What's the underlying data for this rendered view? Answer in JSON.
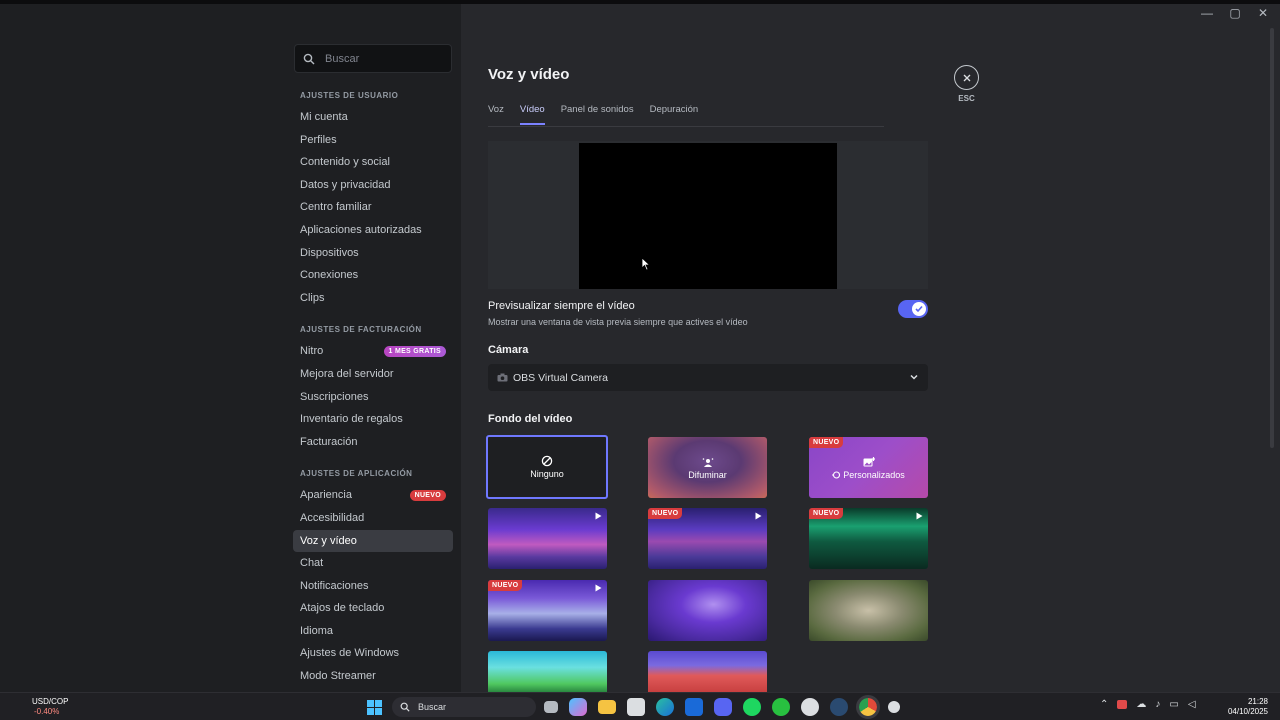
{
  "window": {
    "minimize": "—",
    "maximize": "▢",
    "close": "✕"
  },
  "search": {
    "placeholder": "Buscar"
  },
  "sidebar": {
    "user_header": "AJUSTES DE USUARIO",
    "user_items": [
      "Mi cuenta",
      "Perfiles",
      "Contenido y social",
      "Datos y privacidad",
      "Centro familiar",
      "Aplicaciones autorizadas",
      "Dispositivos",
      "Conexiones",
      "Clips"
    ],
    "billing_header": "AJUSTES DE FACTURACIÓN",
    "billing_items": [
      {
        "label": "Nitro",
        "badge": "1 MES GRATIS"
      },
      {
        "label": "Mejora del servidor"
      },
      {
        "label": "Suscripciones"
      },
      {
        "label": "Inventario de regalos"
      },
      {
        "label": "Facturación"
      }
    ],
    "app_header": "AJUSTES DE APLICACIÓN",
    "app_items": [
      {
        "label": "Apariencia",
        "badge": "NUEVO"
      },
      {
        "label": "Accesibilidad"
      },
      {
        "label": "Voz y vídeo",
        "active": true
      },
      {
        "label": "Chat"
      },
      {
        "label": "Notificaciones"
      },
      {
        "label": "Atajos de teclado"
      },
      {
        "label": "Idioma"
      },
      {
        "label": "Ajustes de Windows"
      },
      {
        "label": "Modo Streamer"
      }
    ]
  },
  "main": {
    "title": "Voz y vídeo",
    "tabs": [
      "Voz",
      "Vídeo",
      "Panel de sonidos",
      "Depuración"
    ],
    "active_tab": "Vídeo",
    "esc_label": "ESC",
    "preview_toggle": {
      "title": "Previsualizar siempre el vídeo",
      "description": "Mostrar una ventana de vista previa siempre que actives el vídeo",
      "enabled": true
    },
    "camera": {
      "label": "Cámara",
      "value": "OBS Virtual Camera"
    },
    "background": {
      "label": "Fondo del vídeo",
      "none_label": "Ninguno",
      "blur_label": "Difuminar",
      "custom_label": "Personalizados",
      "new_badge": "NUEVO"
    }
  },
  "taskbar": {
    "currency": "USD/COP",
    "currency_change": "-0.40%",
    "search": "Buscar",
    "time": "21:28",
    "date": "04/10/2025"
  },
  "colors": {
    "accent": "#5865f2",
    "badge_red": "#d83c3e",
    "bg_content": "#27282c",
    "bg_sidebar": "#1e1f22"
  }
}
